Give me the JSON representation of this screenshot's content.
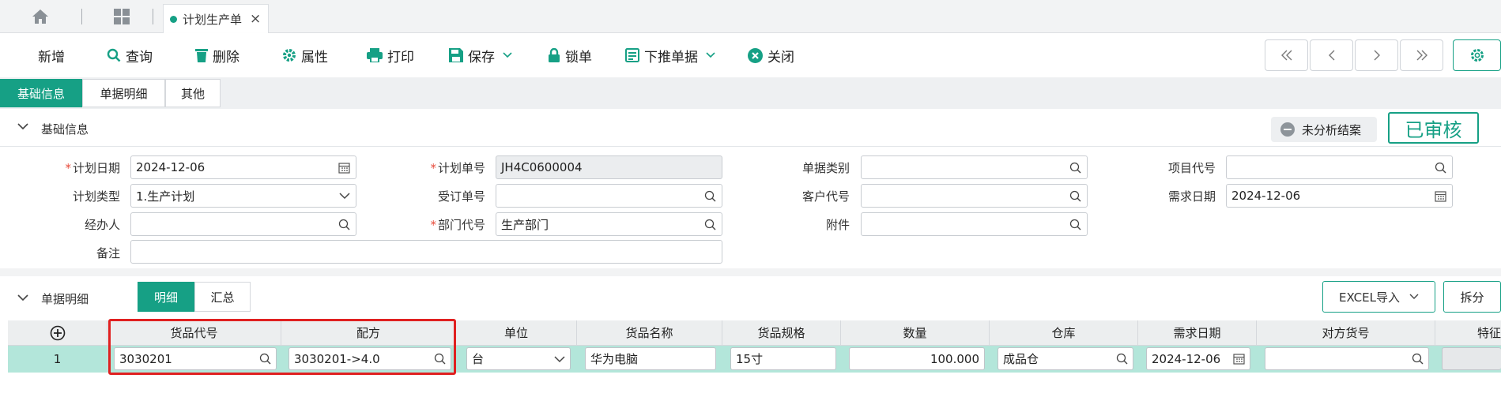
{
  "tab": {
    "label": "计划生产单"
  },
  "toolbar": {
    "add": "新增",
    "query": "查询",
    "delete": "删除",
    "props": "属性",
    "print": "打印",
    "save": "保存",
    "lock": "锁单",
    "push": "下推单据",
    "close": "关闭"
  },
  "subtabs": [
    "基础信息",
    "单据明细",
    "其他"
  ],
  "basic": {
    "title": "基础信息",
    "status_unanalyzed": "未分析结案",
    "status_approved": "已审核"
  },
  "form": {
    "plan_date": {
      "label": "计划日期",
      "value": "2024-12-06"
    },
    "plan_no": {
      "label": "计划单号",
      "value": "JH4C0600004"
    },
    "doc_type": {
      "label": "单据类别",
      "value": ""
    },
    "project_code": {
      "label": "项目代号",
      "value": ""
    },
    "plan_type": {
      "label": "计划类型",
      "value": "1.生产计划"
    },
    "order_no": {
      "label": "受订单号",
      "value": ""
    },
    "customer_code": {
      "label": "客户代号",
      "value": ""
    },
    "need_date": {
      "label": "需求日期",
      "value": "2024-12-06"
    },
    "handler": {
      "label": "经办人",
      "value": ""
    },
    "dept_code": {
      "label": "部门代号",
      "value": "生产部门"
    },
    "attachment": {
      "label": "附件",
      "value": ""
    },
    "remark": {
      "label": "备注",
      "value": ""
    }
  },
  "detail": {
    "title": "单据明细",
    "seg_detail": "明细",
    "seg_summary": "汇总",
    "excel_import": "EXCEL导入",
    "split": "拆分",
    "columns": [
      "货品代号",
      "配方",
      "单位",
      "货品名称",
      "货品规格",
      "数量",
      "仓库",
      "需求日期",
      "对方货号",
      "特征"
    ],
    "row": {
      "index": "1",
      "product_code": "3030201",
      "formula": "3030201->4.0",
      "unit": "台",
      "product_name": "华为电脑",
      "spec": "15寸",
      "qty": "100.000",
      "warehouse": "成品仓",
      "need_date": "2024-12-06",
      "partner_code": "",
      "feature": ""
    }
  },
  "colors": {
    "accent": "#16a085",
    "highlight": "#e02020"
  }
}
